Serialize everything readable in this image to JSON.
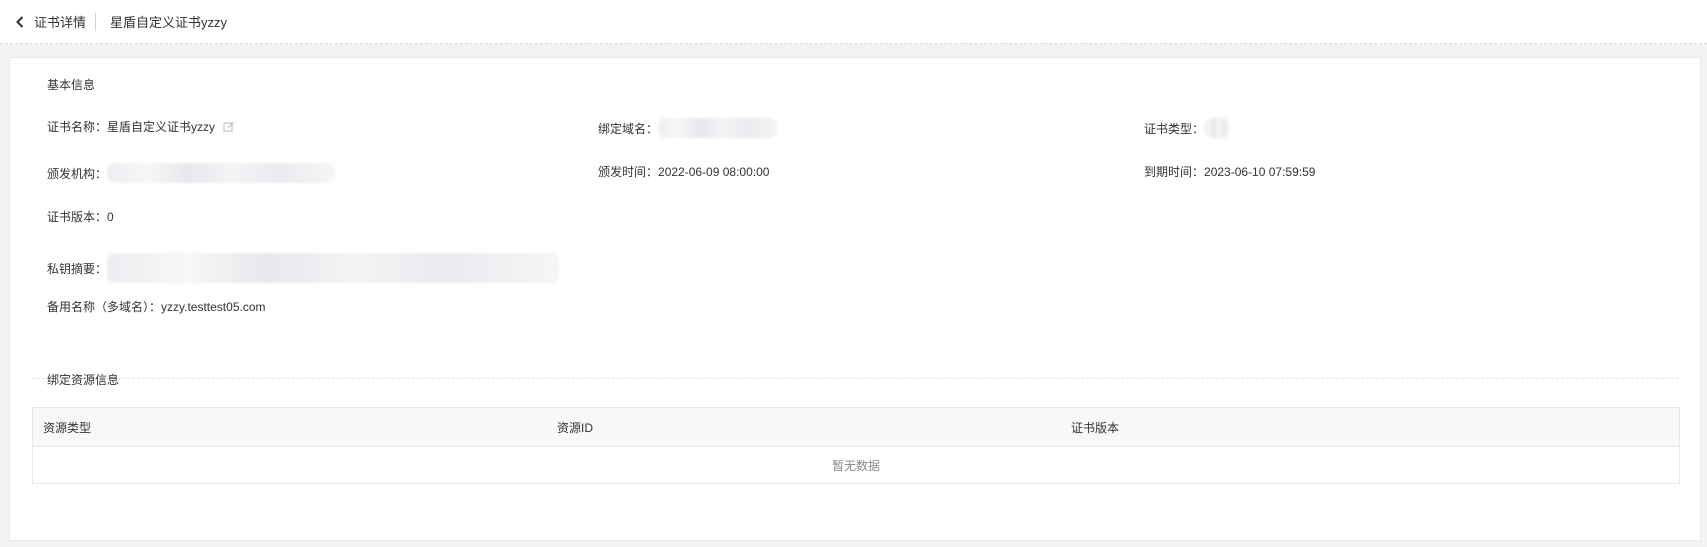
{
  "header": {
    "back_label": "证书详情",
    "title": "星盾自定义证书yzzy"
  },
  "basic_info": {
    "section_title": "基本信息",
    "cert_name_label": "证书名称：",
    "cert_name_value": "星盾自定义证书yzzy",
    "bound_domain_label": "绑定域名：",
    "bound_domain_value": "",
    "cert_type_label": "证书类型：",
    "cert_type_value": "",
    "issuer_label": "颁发机构：",
    "issuer_value": "",
    "issue_time_label": "颁发时间：",
    "issue_time_value": "2022-06-09 08:00:00",
    "expire_time_label": "到期时间：",
    "expire_time_value": "2023-06-10 07:59:59",
    "cert_version_label": "证书版本：",
    "cert_version_value": "0",
    "private_key_label": "私钥摘要：",
    "private_key_value": "",
    "alt_names_label": "备用名称（多域名）：",
    "alt_names_value": "yzzy.testtest05.com"
  },
  "bound_resources": {
    "section_title": "绑定资源信息",
    "columns": [
      "资源类型",
      "资源ID",
      "证书版本"
    ],
    "rows": [],
    "empty_text": "暂无数据"
  },
  "icons": {
    "back": "chevron-left-icon",
    "edit": "edit-icon"
  },
  "colors": {
    "page_bg": "#f2f3f5",
    "card_bg": "#ffffff",
    "table_header_bg": "#f7f8fa"
  }
}
